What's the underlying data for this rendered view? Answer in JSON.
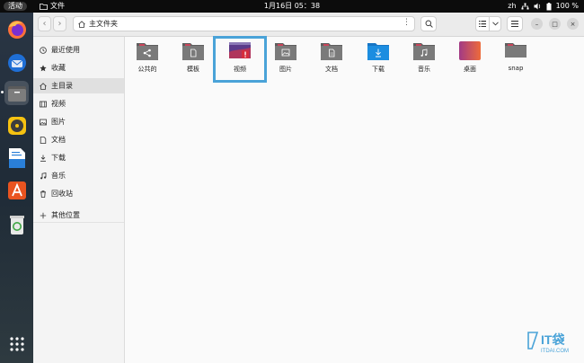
{
  "topbar": {
    "activities": "活动",
    "app_name": "文件",
    "datetime": "1月16日  05：38",
    "input_method": "zh",
    "battery": "100 %"
  },
  "pathbar": {
    "location": "主文件夹"
  },
  "sidebar": {
    "items": [
      {
        "label": "最近使用",
        "icon": "clock-icon"
      },
      {
        "label": "收藏",
        "icon": "star-icon"
      },
      {
        "label": "主目录",
        "icon": "home-icon"
      },
      {
        "label": "视频",
        "icon": "film-icon"
      },
      {
        "label": "图片",
        "icon": "image-icon"
      },
      {
        "label": "文档",
        "icon": "document-icon"
      },
      {
        "label": "下载",
        "icon": "download-icon"
      },
      {
        "label": "音乐",
        "icon": "music-icon"
      },
      {
        "label": "回收站",
        "icon": "trash-icon"
      },
      {
        "label": "其他位置",
        "icon": "plus-icon"
      }
    ],
    "selected": "主目录"
  },
  "folders": [
    {
      "label": "公共的",
      "icon": "share-folder-icon"
    },
    {
      "label": "模板",
      "icon": "template-folder-icon"
    },
    {
      "label": "视频",
      "icon": "video-thumbnail-icon"
    },
    {
      "label": "图片",
      "icon": "pictures-folder-icon"
    },
    {
      "label": "文档",
      "icon": "documents-folder-icon"
    },
    {
      "label": "下载",
      "icon": "downloads-folder-icon"
    },
    {
      "label": "音乐",
      "icon": "music-folder-icon"
    },
    {
      "label": "桌面",
      "icon": "desktop-folder-icon"
    },
    {
      "label": "snap",
      "icon": "folder-icon"
    }
  ],
  "watermark": {
    "brand": "IT袋",
    "url": "ITDAI.COM"
  },
  "colors": {
    "folder": "#6f6f6f",
    "folder_tab": "#c9455a",
    "downloads_folder": "#1c8de0",
    "selection_outline": "#4aa3d8",
    "ubuntu_orange": "#e95420"
  }
}
